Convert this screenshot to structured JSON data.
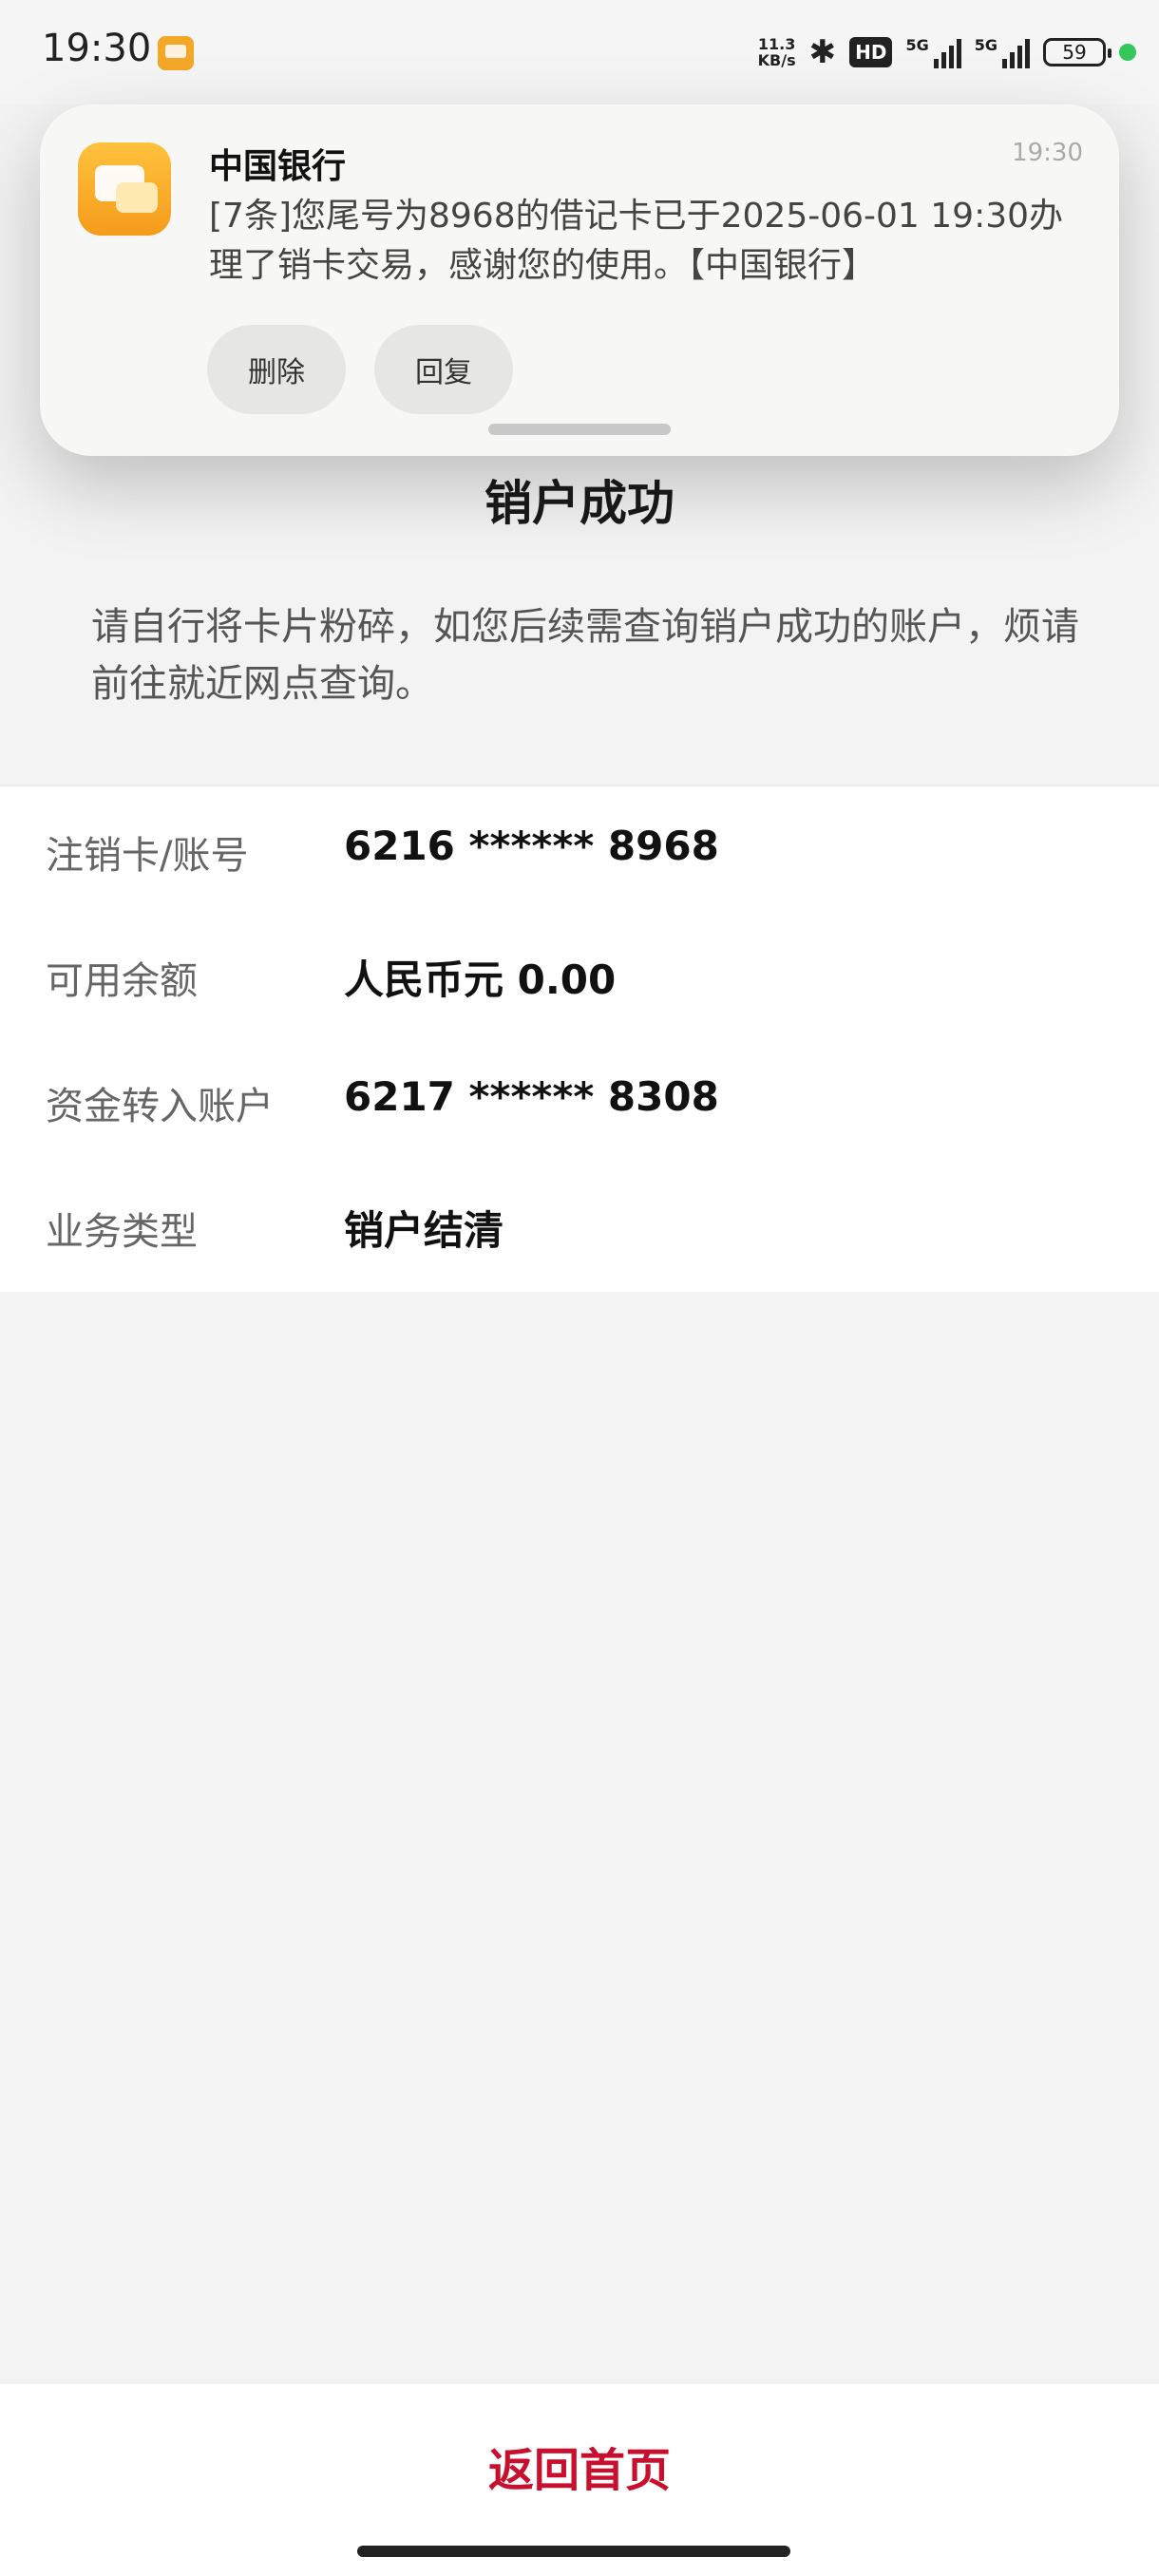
{
  "status_bar": {
    "time": "19:30",
    "net_speed_value": "11.3",
    "net_speed_unit": "KB/s",
    "bluetooth_icon": "bluetooth-icon",
    "hd_label": "HD",
    "signal_1_label": "5G",
    "signal_2_label": "5G",
    "battery": "59",
    "colors": {
      "charging_dot": "#34c759"
    }
  },
  "notification": {
    "app_name": "中国银行",
    "time": "19:30",
    "body": "[7条]您尾号为8968的借记卡已于2025-06-01 19:30办理了销卡交易，感谢您的使用。【中国银行】",
    "actions": {
      "delete": "删除",
      "reply": "回复"
    },
    "icon": "message-icon",
    "colors": {
      "icon": "#f5a623"
    }
  },
  "page": {
    "title": "销户成功",
    "intro": "请自行将卡片粉碎，如您后续需查询销户成功的账户，烦请前往就近网点查询。",
    "details": [
      {
        "label": "注销卡/账号",
        "value": "6216 ****** 8968"
      },
      {
        "label": "可用余额",
        "value": "人民币元 0.00"
      },
      {
        "label": "资金转入账户",
        "value": "6217 ****** 8308"
      },
      {
        "label": "业务类型",
        "value": "销户结清"
      }
    ],
    "home_button": "返回首页",
    "colors": {
      "accent": "#c8102e"
    }
  }
}
